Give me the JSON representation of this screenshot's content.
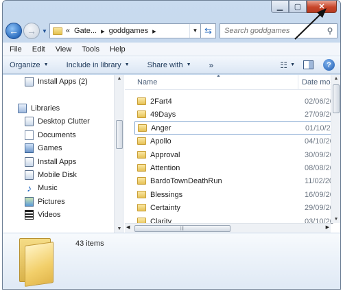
{
  "window": {
    "caption_buttons": {
      "minimize": "▁",
      "maximize": "▢",
      "close": "✕"
    }
  },
  "address": {
    "chevrons": "«",
    "crumbs": [
      "Gate...",
      "goddgames"
    ],
    "search_placeholder": "Search goddgames"
  },
  "menu": [
    "File",
    "Edit",
    "View",
    "Tools",
    "Help"
  ],
  "toolbar": {
    "organize": "Organize",
    "include": "Include in library",
    "share": "Share with",
    "more": "»",
    "help": "?"
  },
  "nav": {
    "items": [
      {
        "label": "Install Apps (2)",
        "icon": "drive-icon"
      },
      {
        "label": "Libraries",
        "icon": "libraries-icon"
      },
      {
        "label": "Desktop Clutter",
        "icon": "library-icon"
      },
      {
        "label": "Documents",
        "icon": "documents-icon"
      },
      {
        "label": "Games",
        "icon": "games-icon"
      },
      {
        "label": "Install Apps",
        "icon": "library-icon"
      },
      {
        "label": "Mobile Disk",
        "icon": "library-icon"
      },
      {
        "label": "Music",
        "icon": "music-icon"
      },
      {
        "label": "Pictures",
        "icon": "pictures-icon"
      },
      {
        "label": "Videos",
        "icon": "videos-icon"
      }
    ]
  },
  "files": {
    "col_name": "Name",
    "col_date": "Date mo",
    "rows": [
      {
        "name": "2Fart4",
        "date": "02/06/20"
      },
      {
        "name": "49Days",
        "date": "27/09/20"
      },
      {
        "name": "Anger",
        "date": "01/10/20"
      },
      {
        "name": "Apollo",
        "date": "04/10/20"
      },
      {
        "name": "Approval",
        "date": "30/09/20"
      },
      {
        "name": "Attention",
        "date": "08/08/20"
      },
      {
        "name": "BardoTownDeathRun",
        "date": "11/02/20"
      },
      {
        "name": "Blessings",
        "date": "16/09/20"
      },
      {
        "name": "Certainty",
        "date": "29/09/20"
      },
      {
        "name": "Clarity",
        "date": "03/10/20"
      }
    ]
  },
  "details": {
    "item_count": "43 items"
  },
  "colors": {
    "accent": "#2e6fc0",
    "close": "#c7452a",
    "selection_border": "#7da2ce"
  }
}
